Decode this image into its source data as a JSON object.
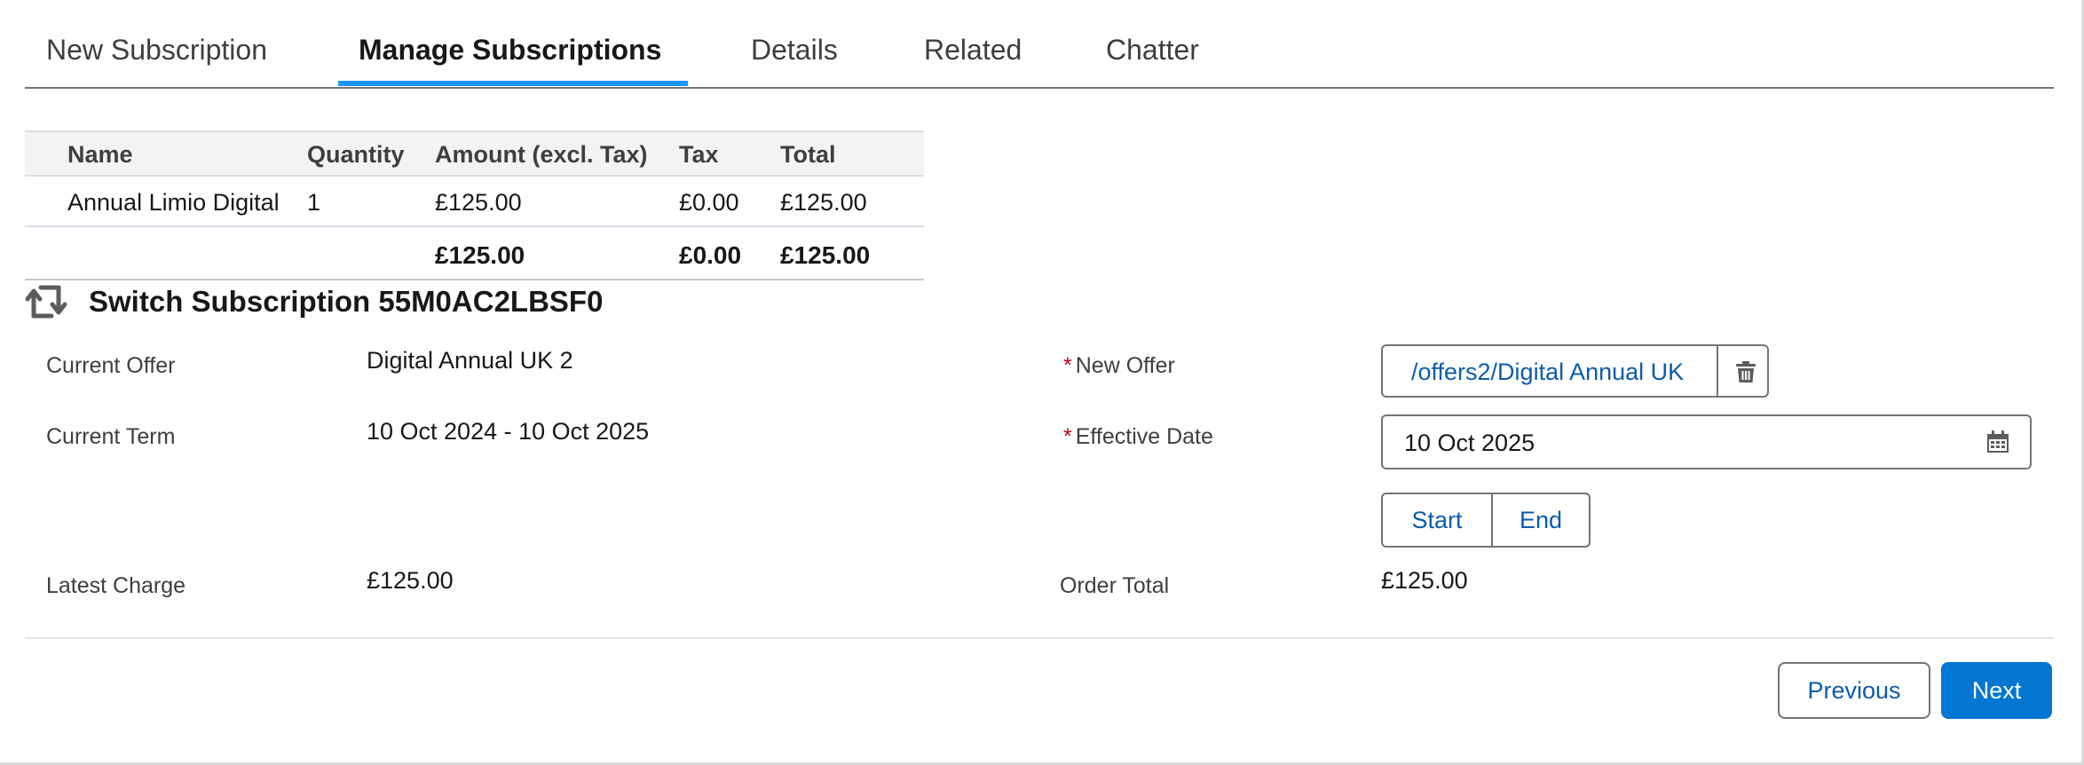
{
  "tabs": [
    {
      "label": "New Subscription"
    },
    {
      "label": "Manage Subscriptions"
    },
    {
      "label": "Details"
    },
    {
      "label": "Related"
    },
    {
      "label": "Chatter"
    }
  ],
  "active_tab": "Manage Subscriptions",
  "summary_table": {
    "headers": [
      "Name",
      "Quantity",
      "Amount (excl. Tax)",
      "Tax",
      "Total"
    ],
    "rows": [
      {
        "name": "Annual Limio Digital",
        "quantity": "1",
        "amount": "£125.00",
        "tax": "£0.00",
        "total": "£125.00"
      }
    ],
    "totals": {
      "amount": "£125.00",
      "tax": "£0.00",
      "total": "£125.00"
    }
  },
  "section": {
    "title": "Switch Subscription 55M0AC2LBSF0",
    "icon": "switch-arrows-icon"
  },
  "fields": {
    "current_offer_label": "Current Offer",
    "current_offer_value": "Digital Annual UK 2",
    "current_term_label": "Current Term",
    "current_term_value": "10 Oct 2024 - 10 Oct 2025",
    "latest_charge_label": "Latest Charge",
    "latest_charge_value": "£125.00",
    "new_offer_label": "New Offer",
    "new_offer_value": "/offers2/Digital Annual UK",
    "effective_date_label": "Effective Date",
    "effective_date_value": "10 Oct 2025",
    "order_total_label": "Order Total",
    "order_total_value": "£125.00",
    "required_marker": "*"
  },
  "date_buttons": {
    "start": "Start",
    "end": "End"
  },
  "footer": {
    "previous": "Previous",
    "next": "Next"
  },
  "colors": {
    "accent": "#1b96ff",
    "brand_button": "#0176d3",
    "link": "#0b5cab",
    "required": "#ba0517"
  }
}
